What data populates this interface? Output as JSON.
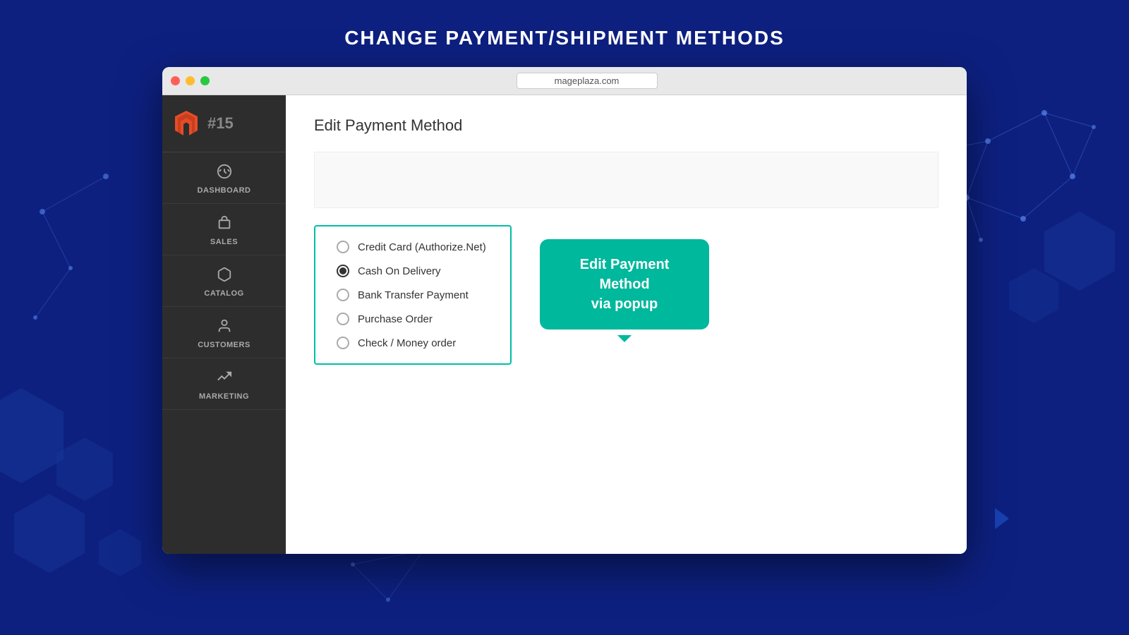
{
  "page": {
    "title": "CHANGE PAYMENT/SHIPMENT METHODS",
    "background_color": "#0d2080"
  },
  "browser": {
    "url": "mageplaza.com",
    "traffic_lights": [
      "red",
      "yellow",
      "green"
    ]
  },
  "sidebar": {
    "logo_order": "#15",
    "items": [
      {
        "id": "dashboard",
        "label": "DASHBOARD",
        "icon": "dashboard"
      },
      {
        "id": "sales",
        "label": "SALES",
        "icon": "sales"
      },
      {
        "id": "catalog",
        "label": "CATALOG",
        "icon": "catalog"
      },
      {
        "id": "customers",
        "label": "CUSTOMERS",
        "icon": "customers"
      },
      {
        "id": "marketing",
        "label": "MARKETING",
        "icon": "marketing"
      }
    ]
  },
  "main": {
    "title": "Edit Payment Method",
    "tooltip": {
      "text_line1": "Edit Payment Method",
      "text_line2": "via popup"
    },
    "payment_options": [
      {
        "id": "credit_card",
        "label": "Credit Card (Authorize.Net)",
        "selected": false
      },
      {
        "id": "cash_on_delivery",
        "label": "Cash On Delivery",
        "selected": true
      },
      {
        "id": "bank_transfer",
        "label": "Bank Transfer Payment",
        "selected": false
      },
      {
        "id": "purchase_order",
        "label": "Purchase Order",
        "selected": false
      },
      {
        "id": "check_money",
        "label": "Check / Money order",
        "selected": false
      }
    ]
  }
}
